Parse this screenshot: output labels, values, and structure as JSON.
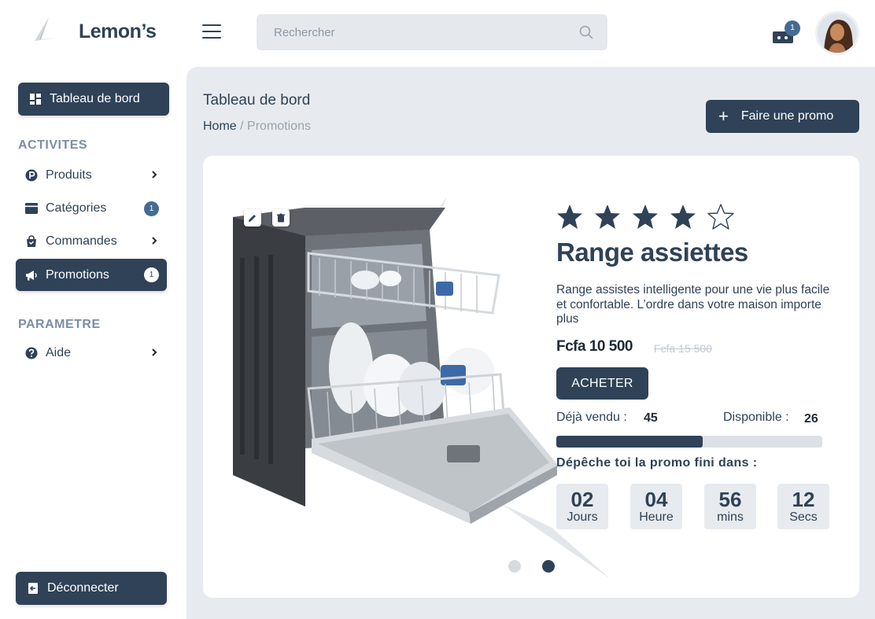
{
  "brand": {
    "name": "Lemon’s"
  },
  "search": {
    "placeholder": "Rechercher"
  },
  "notifications": {
    "count": "1"
  },
  "sidebar": {
    "dashboard_label": "Tableau de bord",
    "sections": [
      {
        "title": "ACTIVITES"
      },
      {
        "title": "PARAMETRE"
      }
    ],
    "items": [
      {
        "label": "Produits",
        "icon": "parking-circle-icon"
      },
      {
        "label": "Catégories",
        "icon": "card-icon",
        "count": "1"
      },
      {
        "label": "Commandes",
        "icon": "shopping-bag-icon"
      },
      {
        "label": "Promotions",
        "icon": "megaphone-icon",
        "count": "1",
        "active": true
      },
      {
        "label": "Aide",
        "icon": "question-circle-icon"
      }
    ],
    "logout_label": "Déconnecter"
  },
  "header": {
    "title": "Tableau de bord",
    "breadcrumb": {
      "home": "Home",
      "separator": "/",
      "current": "Promotions"
    },
    "promo_button": "Faire une promo"
  },
  "product": {
    "rating": 4,
    "rating_max": 5,
    "title": "Range assiettes",
    "description": "Range assistes intelligente pour une vie plus facile et confortable. L’ordre dans votre maison importe plus",
    "price": "Fcfa 10 500",
    "old_price": "Fcfa 15 500",
    "buy_label": "ACHETER",
    "sold_label": "Déjà vendu :",
    "sold_value": "45",
    "available_label": "Disponible :",
    "available_value": "26",
    "sold_fraction": 0.55,
    "hurry_text": "Dépêche toi la promo fini dans :",
    "countdown": [
      {
        "value": "02",
        "unit": "Jours"
      },
      {
        "value": "04",
        "unit": "Heure"
      },
      {
        "value": "56",
        "unit": "mins"
      },
      {
        "value": "12",
        "unit": "Secs"
      }
    ]
  },
  "carousel": {
    "active_index": 1,
    "count": 2
  },
  "colors": {
    "primary": "#2f4257",
    "accent": "#456a94",
    "background": "#e7ebef"
  }
}
